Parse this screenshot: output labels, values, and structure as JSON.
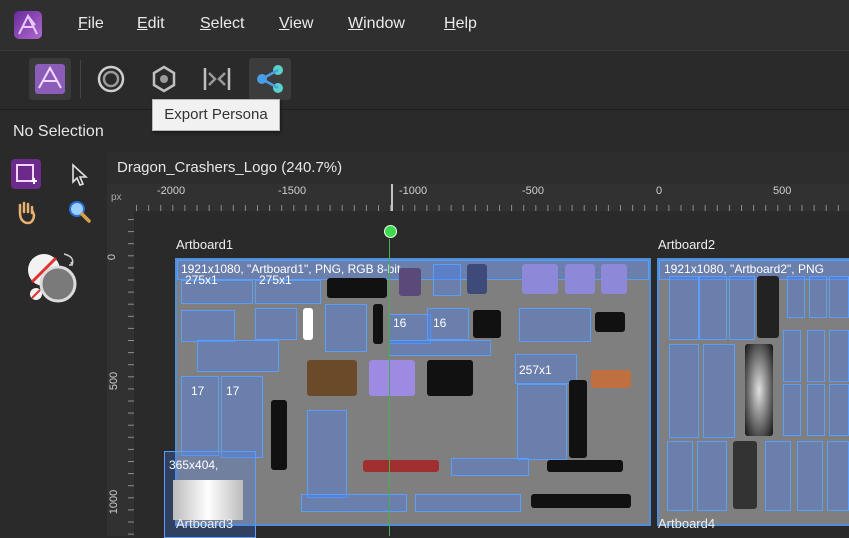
{
  "menubar": {
    "items": [
      "File",
      "Edit",
      "Select",
      "View",
      "Window",
      "Help"
    ],
    "mnemonics": [
      "F",
      "E",
      "S",
      "V",
      "W",
      "H"
    ],
    "rest": [
      "ile",
      "dit",
      "elect",
      "iew",
      "indow",
      "elp"
    ]
  },
  "persona": {
    "tooltip": "Export Persona",
    "icons": [
      "photo-persona-icon",
      "liquify-persona-icon",
      "develop-persona-icon",
      "tone-mapping-persona-icon",
      "export-persona-icon"
    ]
  },
  "context": {
    "status": "No Selection"
  },
  "document": {
    "title": "Dragon_Crashers_Logo (240.7%)"
  },
  "ruler": {
    "unit": "px",
    "h_ticks": [
      "-2000",
      "-1500",
      "-1000",
      "-500",
      "0",
      "500"
    ],
    "v_ticks": [
      "0",
      "500",
      "1000"
    ]
  },
  "artboards": {
    "ab1": {
      "name": "Artboard1",
      "slice": "1921x1080, \"Artboard1\", PNG, RGB 8-bit"
    },
    "ab2": {
      "name": "Artboard2",
      "slice": "1921x1080, \"Artboard2\", PNG"
    },
    "ab3": {
      "name": "Artboard3",
      "slice": "365x404,"
    },
    "ab4": {
      "name": "Artboard4"
    }
  },
  "slices": {
    "a": "275x1",
    "b": "275x1",
    "c": "16",
    "d": "16",
    "e": "257x1",
    "f": "17",
    "g": "17"
  },
  "colors": {
    "accent": "#4f8ed8",
    "selection": "#5a9eff",
    "brand": "#7a3aa8"
  }
}
